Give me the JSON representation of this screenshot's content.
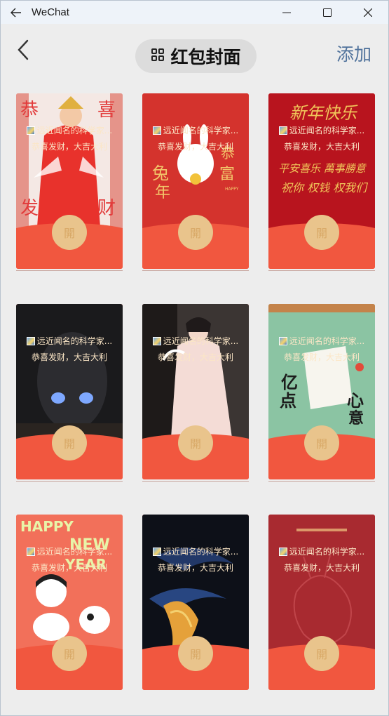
{
  "window": {
    "title": "WeChat"
  },
  "header": {
    "title": "红包封面",
    "add_label": "添加"
  },
  "cards": [
    {
      "sender": "远近闻名的科学家...",
      "wish": "恭喜发财，大吉大利",
      "open": "開",
      "theme": "girl-red"
    },
    {
      "sender": "远近闻名的科学家...",
      "wish": "恭喜发财，大吉大利",
      "open": "開",
      "theme": "rabbit-red"
    },
    {
      "sender": "远近闻名的科学家...",
      "wish": "恭喜发财，大吉大利",
      "open": "開",
      "theme": "calligraphy"
    },
    {
      "sender": "远近闻名的科学家...",
      "wish": "恭喜发财，大吉大利",
      "open": "開",
      "theme": "motorbike"
    },
    {
      "sender": "远近闻名的科学家...",
      "wish": "恭喜发财，大吉大利",
      "open": "開",
      "theme": "swing-girl"
    },
    {
      "sender": "远近闻名的科学家...",
      "wish": "恭喜发财，大吉大利",
      "open": "開",
      "theme": "green-rabbit"
    },
    {
      "sender": "远近闻名的科学家...",
      "wish": "恭喜发财，大吉大利",
      "open": "開",
      "theme": "happy-new-year"
    },
    {
      "sender": "远近闻名的科学家...",
      "wish": "恭喜发财，大吉大利",
      "open": "開",
      "theme": "koi"
    },
    {
      "sender": "远近闻名的科学家...",
      "wish": "恭喜发财，大吉大利",
      "open": "開",
      "theme": "dark-red-rabbit"
    }
  ],
  "art_text": {
    "card1": [
      "恭",
      "喜",
      "发",
      "财"
    ],
    "card2": [
      "兔",
      "年",
      "恭",
      "富",
      "HAPPY"
    ],
    "card3": [
      "新年快乐",
      "平安喜乐 萬事勝意",
      "祝你 权钱 权我们"
    ],
    "card6": [
      "亿",
      "点",
      "心",
      "意"
    ],
    "card7": [
      "HAPPY",
      "NEW",
      "YEAR"
    ]
  },
  "colors": {
    "accent": "#51739c",
    "envelope": "#f1573f",
    "open_button": "#e9c48c"
  }
}
